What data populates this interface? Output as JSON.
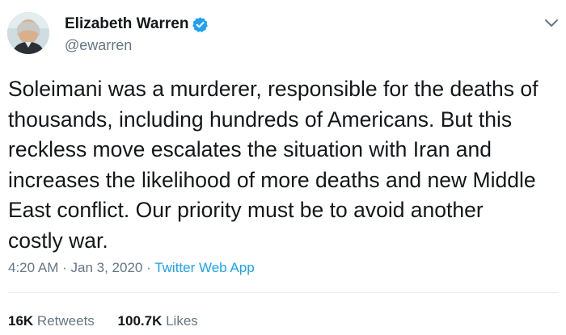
{
  "author": {
    "display_name": "Elizabeth Warren",
    "handle": "@ewarren",
    "verified_icon": "verified-badge-icon",
    "avatar_icon": "profile-photo"
  },
  "tweet": {
    "text": "Soleimani was a murderer, responsible for the deaths of\nthousands, including hundreds of Americans. But this\nreckless move escalates the situation with Iran and\nincreases the likelihood of more deaths and new Middle\nEast conflict. Our priority must be to avoid another\ncostly war.",
    "time": "4:20 AM",
    "date": "Jan 3, 2020",
    "separator": "·",
    "source": "Twitter Web App"
  },
  "stats": {
    "retweets_count": "16K",
    "retweets_label": "Retweets",
    "likes_count": "100.7K",
    "likes_label": "Likes"
  },
  "colors": {
    "link": "#1da1f2",
    "secondary_text": "#657786",
    "primary_text": "#14171a"
  },
  "menu_icon": "chevron-down-icon"
}
